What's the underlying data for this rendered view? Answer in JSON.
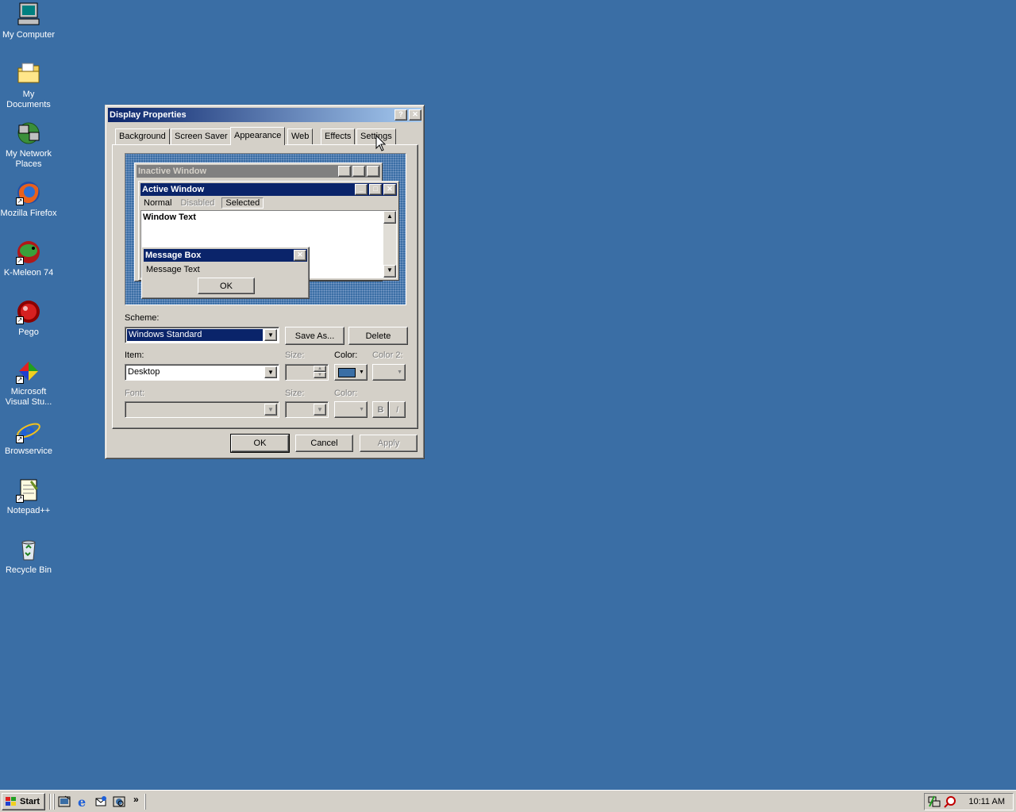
{
  "desktop": {
    "icons": [
      {
        "label": "My Computer"
      },
      {
        "label": "My Documents"
      },
      {
        "label": "My Network Places"
      },
      {
        "label": "Mozilla Firefox"
      },
      {
        "label": "K-Meleon 74"
      },
      {
        "label": "Pego"
      },
      {
        "label": "Microsoft Visual Stu..."
      },
      {
        "label": "Browservice"
      },
      {
        "label": "Notepad++"
      },
      {
        "label": "Recycle Bin"
      }
    ]
  },
  "dialog": {
    "title": "Display Properties",
    "help_glyph": "?",
    "close_glyph": "✕",
    "tabs": [
      {
        "label": "Background"
      },
      {
        "label": "Screen Saver"
      },
      {
        "label": "Appearance"
      },
      {
        "label": "Web"
      },
      {
        "label": "Effects"
      },
      {
        "label": "Settings"
      }
    ],
    "active_tab": "Appearance",
    "preview": {
      "inactive_title": "Inactive Window",
      "active_title": "Active Window",
      "menu_normal": "Normal",
      "menu_disabled": "Disabled",
      "menu_selected": "Selected",
      "window_text": "Window Text",
      "msgbox_title": "Message Box",
      "msgbox_text": "Message Text",
      "msgbox_ok": "OK"
    },
    "scheme_label": "Scheme:",
    "scheme_value": "Windows Standard",
    "save_as_label": "Save As...",
    "delete_label": "Delete",
    "item_label": "Item:",
    "item_value": "Desktop",
    "size_label": "Size:",
    "color_label": "Color:",
    "color2_label": "Color 2:",
    "color_value": "#3a6ea5",
    "font_label": "Font:",
    "font_size_label": "Size:",
    "font_color_label": "Color:",
    "bold_label": "B",
    "italic_label": "I",
    "ok_label": "OK",
    "cancel_label": "Cancel",
    "apply_label": "Apply"
  },
  "taskbar": {
    "start_label": "Start",
    "more_glyph": "»",
    "clock": "10:11 AM"
  },
  "colors": {
    "desktop": "#3a6ea5",
    "title_active": "#0a246a",
    "title_inactive": "#808080",
    "face": "#d4d0c8"
  }
}
